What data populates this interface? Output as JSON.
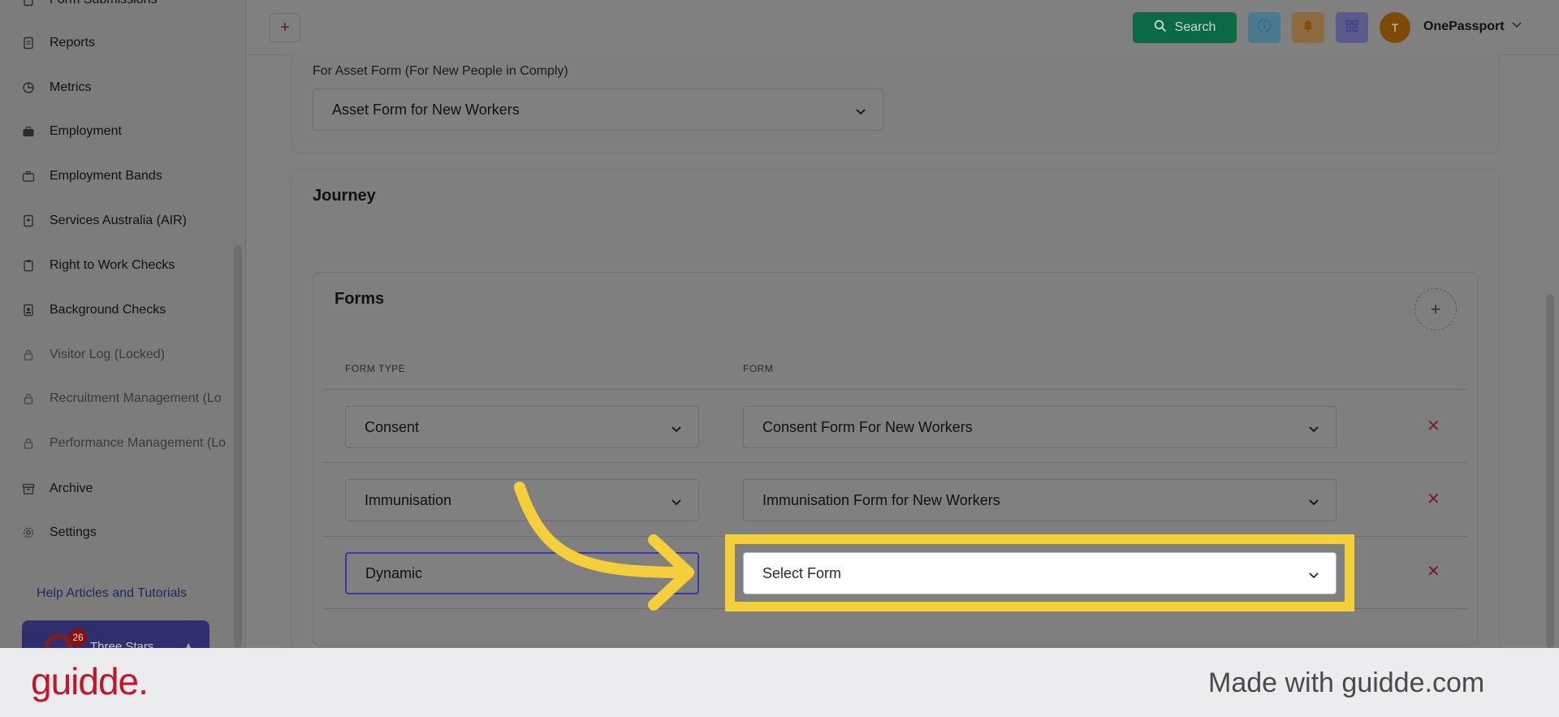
{
  "sidebar": {
    "items": [
      {
        "label": "Form Submissions",
        "icon": "file-icon",
        "locked": false
      },
      {
        "label": "Reports",
        "icon": "report-icon",
        "locked": false
      },
      {
        "label": "Metrics",
        "icon": "pie-chart-icon",
        "locked": false
      },
      {
        "label": "Employment",
        "icon": "briefcase-icon",
        "locked": false
      },
      {
        "label": "Employment Bands",
        "icon": "briefcase-outline-icon",
        "locked": false
      },
      {
        "label": "Services Australia (AIR)",
        "icon": "id-card-icon",
        "locked": false
      },
      {
        "label": "Right to Work Checks",
        "icon": "clipboard-icon",
        "locked": false
      },
      {
        "label": "Background Checks",
        "icon": "document-icon",
        "locked": false
      },
      {
        "label": "Visitor Log (Locked)",
        "icon": "lock-icon",
        "locked": true
      },
      {
        "label": "Recruitment Management (Lo",
        "icon": "lock-icon",
        "locked": true
      },
      {
        "label": "Performance Management (Lo",
        "icon": "lock-icon",
        "locked": true
      },
      {
        "label": "Archive",
        "icon": "archive-icon",
        "locked": false
      },
      {
        "label": "Settings",
        "icon": "gear-icon",
        "locked": false
      }
    ],
    "help_link": "Help Articles and Tutorials",
    "profile": {
      "name": "Three Stars",
      "badge": "26"
    }
  },
  "topbar": {
    "add_label": "+",
    "search_label": "Search",
    "avatar_initial": "T",
    "user_name": "OnePassport"
  },
  "asset": {
    "label": "For Asset Form (For New People in Comply)",
    "value": "Asset Form for New Workers"
  },
  "journey": {
    "title": "Journey",
    "forms_title": "Forms",
    "col_form_type": "FORM TYPE",
    "col_form": "FORM",
    "rows": [
      {
        "type": "Consent",
        "form": "Consent Form For New Workers"
      },
      {
        "type": "Immunisation",
        "form": "Immunisation Form for New Workers"
      },
      {
        "type": "Dynamic",
        "form": "Select Form"
      }
    ],
    "delete_glyph": "✕"
  },
  "footer": {
    "logo": "guidde.",
    "made_with": "Made with guidde.com"
  },
  "colors": {
    "highlight": "#f5cf3a",
    "search_btn": "#0a6a45",
    "delete": "#c0182a"
  }
}
